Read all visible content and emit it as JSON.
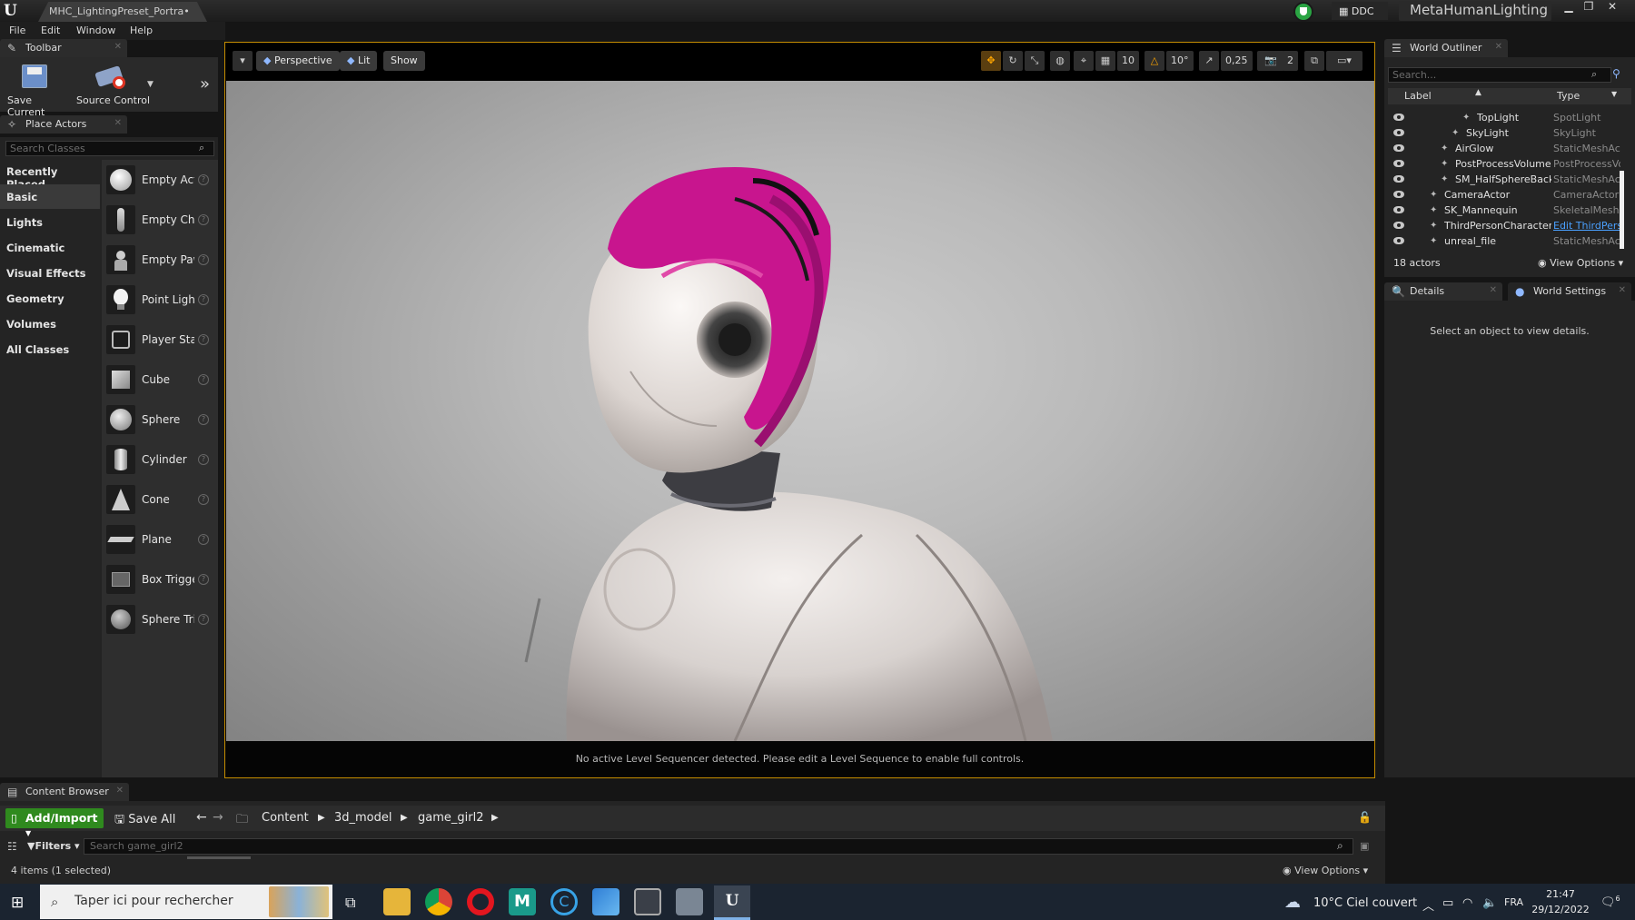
{
  "window": {
    "tab_title": "MHC_LightingPreset_Portra•",
    "ddc_label": "DDC",
    "project_name": "MetaHumanLighting"
  },
  "menu": [
    "File",
    "Edit",
    "Window",
    "Help"
  ],
  "toolbar": {
    "tab_label": "Toolbar",
    "save_label": "Save Current",
    "source_control_label": "Source Control"
  },
  "place_actors": {
    "tab_label": "Place Actors",
    "search_placeholder": "Search Classes",
    "categories": [
      "Recently Placed",
      "Basic",
      "Lights",
      "Cinematic",
      "Visual Effects",
      "Geometry",
      "Volumes",
      "All Classes"
    ],
    "active_category": "Basic",
    "items": [
      "Empty Actor",
      "Empty Character",
      "Empty Pawn",
      "Point Light",
      "Player Start",
      "Cube",
      "Sphere",
      "Cylinder",
      "Cone",
      "Plane",
      "Box Trigger",
      "Sphere Trigger"
    ]
  },
  "viewport": {
    "perspective_label": "Perspective",
    "lit_label": "Lit",
    "show_label": "Show",
    "grid_snap": "10",
    "rot_snap": "10°",
    "scale_snap": "0,25",
    "camera_speed": "2",
    "status_message": "No active Level Sequencer detected. Please edit a Level Sequence to enable full controls."
  },
  "outliner": {
    "tab_label": "World Outliner",
    "search_placeholder": "Search...",
    "col_label": "Label",
    "col_type": "Type",
    "rows": [
      {
        "label": "TopLight",
        "type": "SpotLight",
        "indent": 3
      },
      {
        "label": "SkyLight",
        "type": "SkyLight",
        "indent": 2
      },
      {
        "label": "AirGlow",
        "type": "StaticMeshActor",
        "indent": 1
      },
      {
        "label": "PostProcessVolume",
        "type": "PostProcessVolume",
        "indent": 1
      },
      {
        "label": "SM_HalfSphereBackground",
        "type": "StaticMeshActor",
        "indent": 1
      },
      {
        "label": "CameraActor",
        "type": "CameraActor",
        "indent": 0
      },
      {
        "label": "SK_Mannequin",
        "type": "SkeletalMeshActor",
        "indent": 0
      },
      {
        "label": "ThirdPersonCharacter",
        "type": "Edit ThirdPersonCharacter",
        "indent": 0,
        "link": true
      },
      {
        "label": "unreal_file",
        "type": "StaticMeshActor",
        "indent": 0
      }
    ],
    "actor_count": "18 actors",
    "view_options": "View Options"
  },
  "details": {
    "tab_label": "Details",
    "world_settings_label": "World Settings",
    "empty_message": "Select an object to view details."
  },
  "content_browser": {
    "tab_label": "Content Browser",
    "add_import_label": "Add/Import",
    "save_all_label": "Save All",
    "breadcrumb": [
      "Content",
      "3d_model",
      "game_girl2"
    ],
    "filters_label": "Filters",
    "search_placeholder": "Search game_girl2",
    "items_status": "4 items (1 selected)",
    "view_options": "View Options"
  },
  "taskbar": {
    "search_placeholder": "Taper ici pour rechercher",
    "weather": "10°C  Ciel couvert",
    "lang": "FRA",
    "time": "21:47",
    "date": "29/12/2022",
    "notifications": "6"
  },
  "colors": {
    "accent_orange": "#c58d00",
    "add_green": "#2f8a1e",
    "hair_magenta": "#c8158e",
    "link_blue": "#4aa0ff"
  }
}
